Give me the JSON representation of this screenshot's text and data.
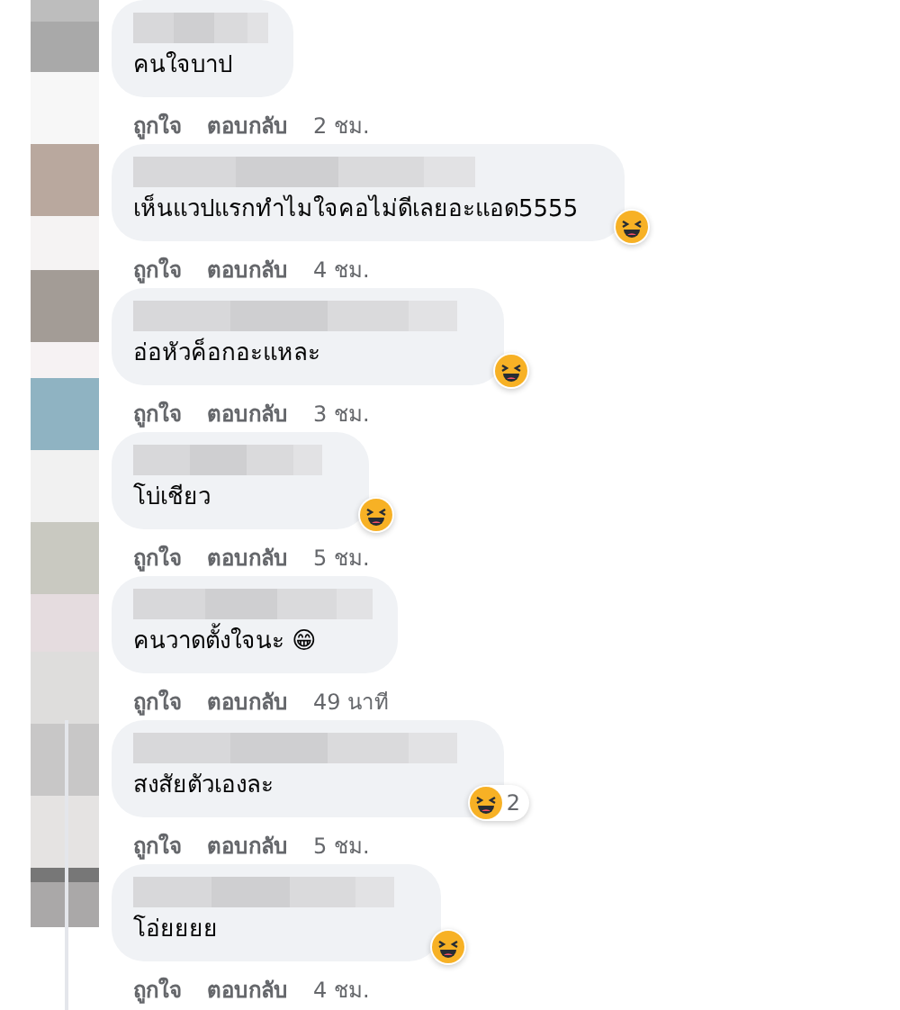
{
  "comments": [
    {
      "text": "คนใจบาป",
      "like": "ถูกใจ",
      "reply": "ตอบกลับ",
      "time": "2 ชม."
    },
    {
      "text": "เห็นแวปแรกทำไมใจคอไม่ดีเลยอะแอด5555",
      "like": "ถูกใจ",
      "reply": "ตอบกลับ",
      "time": "4 ชม.",
      "reaction": {
        "kind": "haha"
      }
    },
    {
      "text": "อ่อหัวค็อกอะแหละ",
      "like": "ถูกใจ",
      "reply": "ตอบกลับ",
      "time": "3 ชม.",
      "reaction": {
        "kind": "haha"
      }
    },
    {
      "text": "โบ่เชียว",
      "like": "ถูกใจ",
      "reply": "ตอบกลับ",
      "time": "5 ชม.",
      "reaction": {
        "kind": "haha"
      }
    },
    {
      "text": "คนวาดตั้งใจนะ 😁",
      "like": "ถูกใจ",
      "reply": "ตอบกลับ",
      "time": "49 นาที"
    },
    {
      "text": "สงสัยตัวเองละ",
      "like": "ถูกใจ",
      "reply": "ตอบกลับ",
      "time": "5 ชม.",
      "reaction": {
        "kind": "haha",
        "count": "2"
      }
    },
    {
      "text": "โอ่ยยยย",
      "like": "ถูกใจ",
      "reply": "ตอบกลับ",
      "time": "4 ชม.",
      "reaction": {
        "kind": "haha"
      }
    }
  ]
}
